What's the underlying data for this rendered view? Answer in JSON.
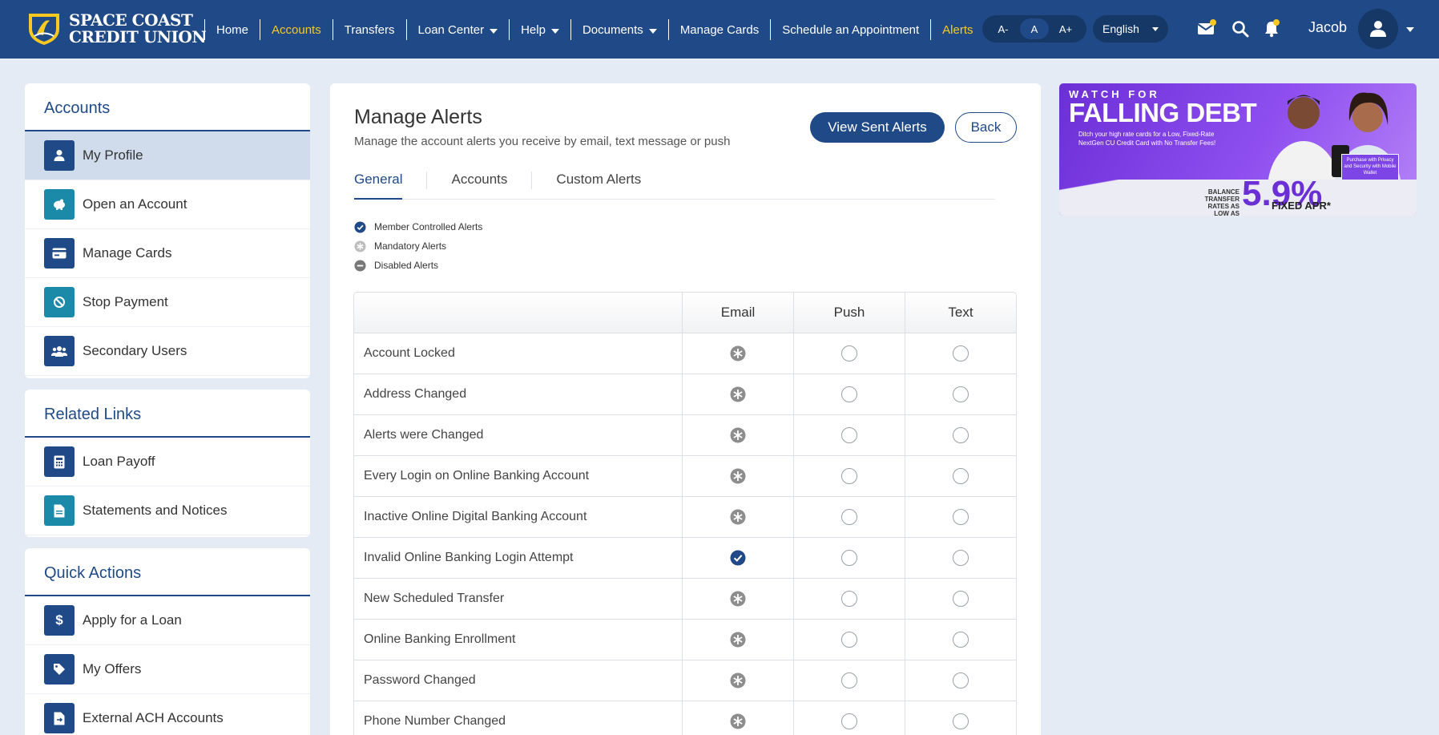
{
  "brand": {
    "line1": "SPACE COAST",
    "line2": "CREDIT UNION"
  },
  "nav": {
    "items": [
      {
        "label": "Home"
      },
      {
        "label": "Accounts",
        "active": true
      },
      {
        "label": "Transfers"
      },
      {
        "label": "Loan Center",
        "dropdown": true
      },
      {
        "label": "Help",
        "dropdown": true
      },
      {
        "label": "Documents",
        "dropdown": true
      },
      {
        "label": "Manage Cards"
      },
      {
        "label": "Schedule an Appointment"
      },
      {
        "label": "Alerts",
        "active": true
      }
    ],
    "font_size": {
      "decrease": "A-",
      "default": "A",
      "increase": "A+"
    },
    "language": "English",
    "user_name": "Jacob"
  },
  "sidebar": {
    "accounts": {
      "title": "Accounts",
      "items": [
        {
          "label": "My Profile",
          "icon": "user-icon"
        },
        {
          "label": "Open an Account",
          "icon": "piggy-bank-icon"
        },
        {
          "label": "Manage Cards",
          "icon": "credit-card-icon"
        },
        {
          "label": "Stop Payment",
          "icon": "ban-icon"
        },
        {
          "label": "Secondary Users",
          "icon": "users-icon"
        }
      ]
    },
    "related": {
      "title": "Related Links",
      "items": [
        {
          "label": "Loan Payoff",
          "icon": "calculator-icon"
        },
        {
          "label": "Statements and Notices",
          "icon": "document-icon"
        }
      ]
    },
    "quick": {
      "title": "Quick Actions",
      "items": [
        {
          "label": "Apply for a Loan",
          "icon": "dollar-icon"
        },
        {
          "label": "My Offers",
          "icon": "tag-icon"
        },
        {
          "label": "External ACH Accounts",
          "icon": "file-transfer-icon"
        }
      ]
    }
  },
  "main": {
    "title": "Manage Alerts",
    "subtitle": "Manage the account alerts you receive by email, text message or push",
    "view_sent_label": "View Sent Alerts",
    "back_label": "Back",
    "tabs": [
      {
        "label": "General",
        "active": true
      },
      {
        "label": "Accounts"
      },
      {
        "label": "Custom Alerts"
      }
    ],
    "legend": [
      {
        "label": "Member Controlled Alerts",
        "icon": "check-circle-icon"
      },
      {
        "label": "Mandatory Alerts",
        "icon": "asterisk-icon"
      },
      {
        "label": "Disabled Alerts",
        "icon": "minus-circle-icon"
      }
    ],
    "table": {
      "headers": [
        "",
        "Email",
        "Push",
        "Text"
      ],
      "rows": [
        {
          "name": "Account Locked",
          "email": "mandatory",
          "push": "off",
          "text": "off"
        },
        {
          "name": "Address Changed",
          "email": "mandatory",
          "push": "off",
          "text": "off"
        },
        {
          "name": "Alerts were Changed",
          "email": "mandatory",
          "push": "off",
          "text": "off"
        },
        {
          "name": "Every Login on Online Banking Account",
          "email": "mandatory",
          "push": "off",
          "text": "off"
        },
        {
          "name": "Inactive Online Digital Banking Account",
          "email": "mandatory",
          "push": "off",
          "text": "off"
        },
        {
          "name": "Invalid Online Banking Login Attempt",
          "email": "checked",
          "push": "off",
          "text": "off"
        },
        {
          "name": "New Scheduled Transfer",
          "email": "mandatory",
          "push": "off",
          "text": "off"
        },
        {
          "name": "Online Banking Enrollment",
          "email": "mandatory",
          "push": "off",
          "text": "off"
        },
        {
          "name": "Password Changed",
          "email": "mandatory",
          "push": "off",
          "text": "off"
        },
        {
          "name": "Phone Number Changed",
          "email": "mandatory",
          "push": "off",
          "text": "off"
        }
      ]
    }
  },
  "ad": {
    "watch": "WATCH FOR",
    "headline": "FALLING DEBT",
    "body": "Ditch your high rate cards for a Low, Fixed-Rate NextGen CU Credit Card with No Transfer Fees!",
    "balance_label": "BALANCE TRANSFER RATES AS LOW AS",
    "rate": "5.9%",
    "apr": "FIXED APR*",
    "purchase": "Purchase with Privacy and Security with Mobile Wallet"
  },
  "colors": {
    "navy": "#1f4a87",
    "gold": "#f9c922",
    "teal": "#1b8aa9",
    "selected_bg": "#d0dcec"
  }
}
